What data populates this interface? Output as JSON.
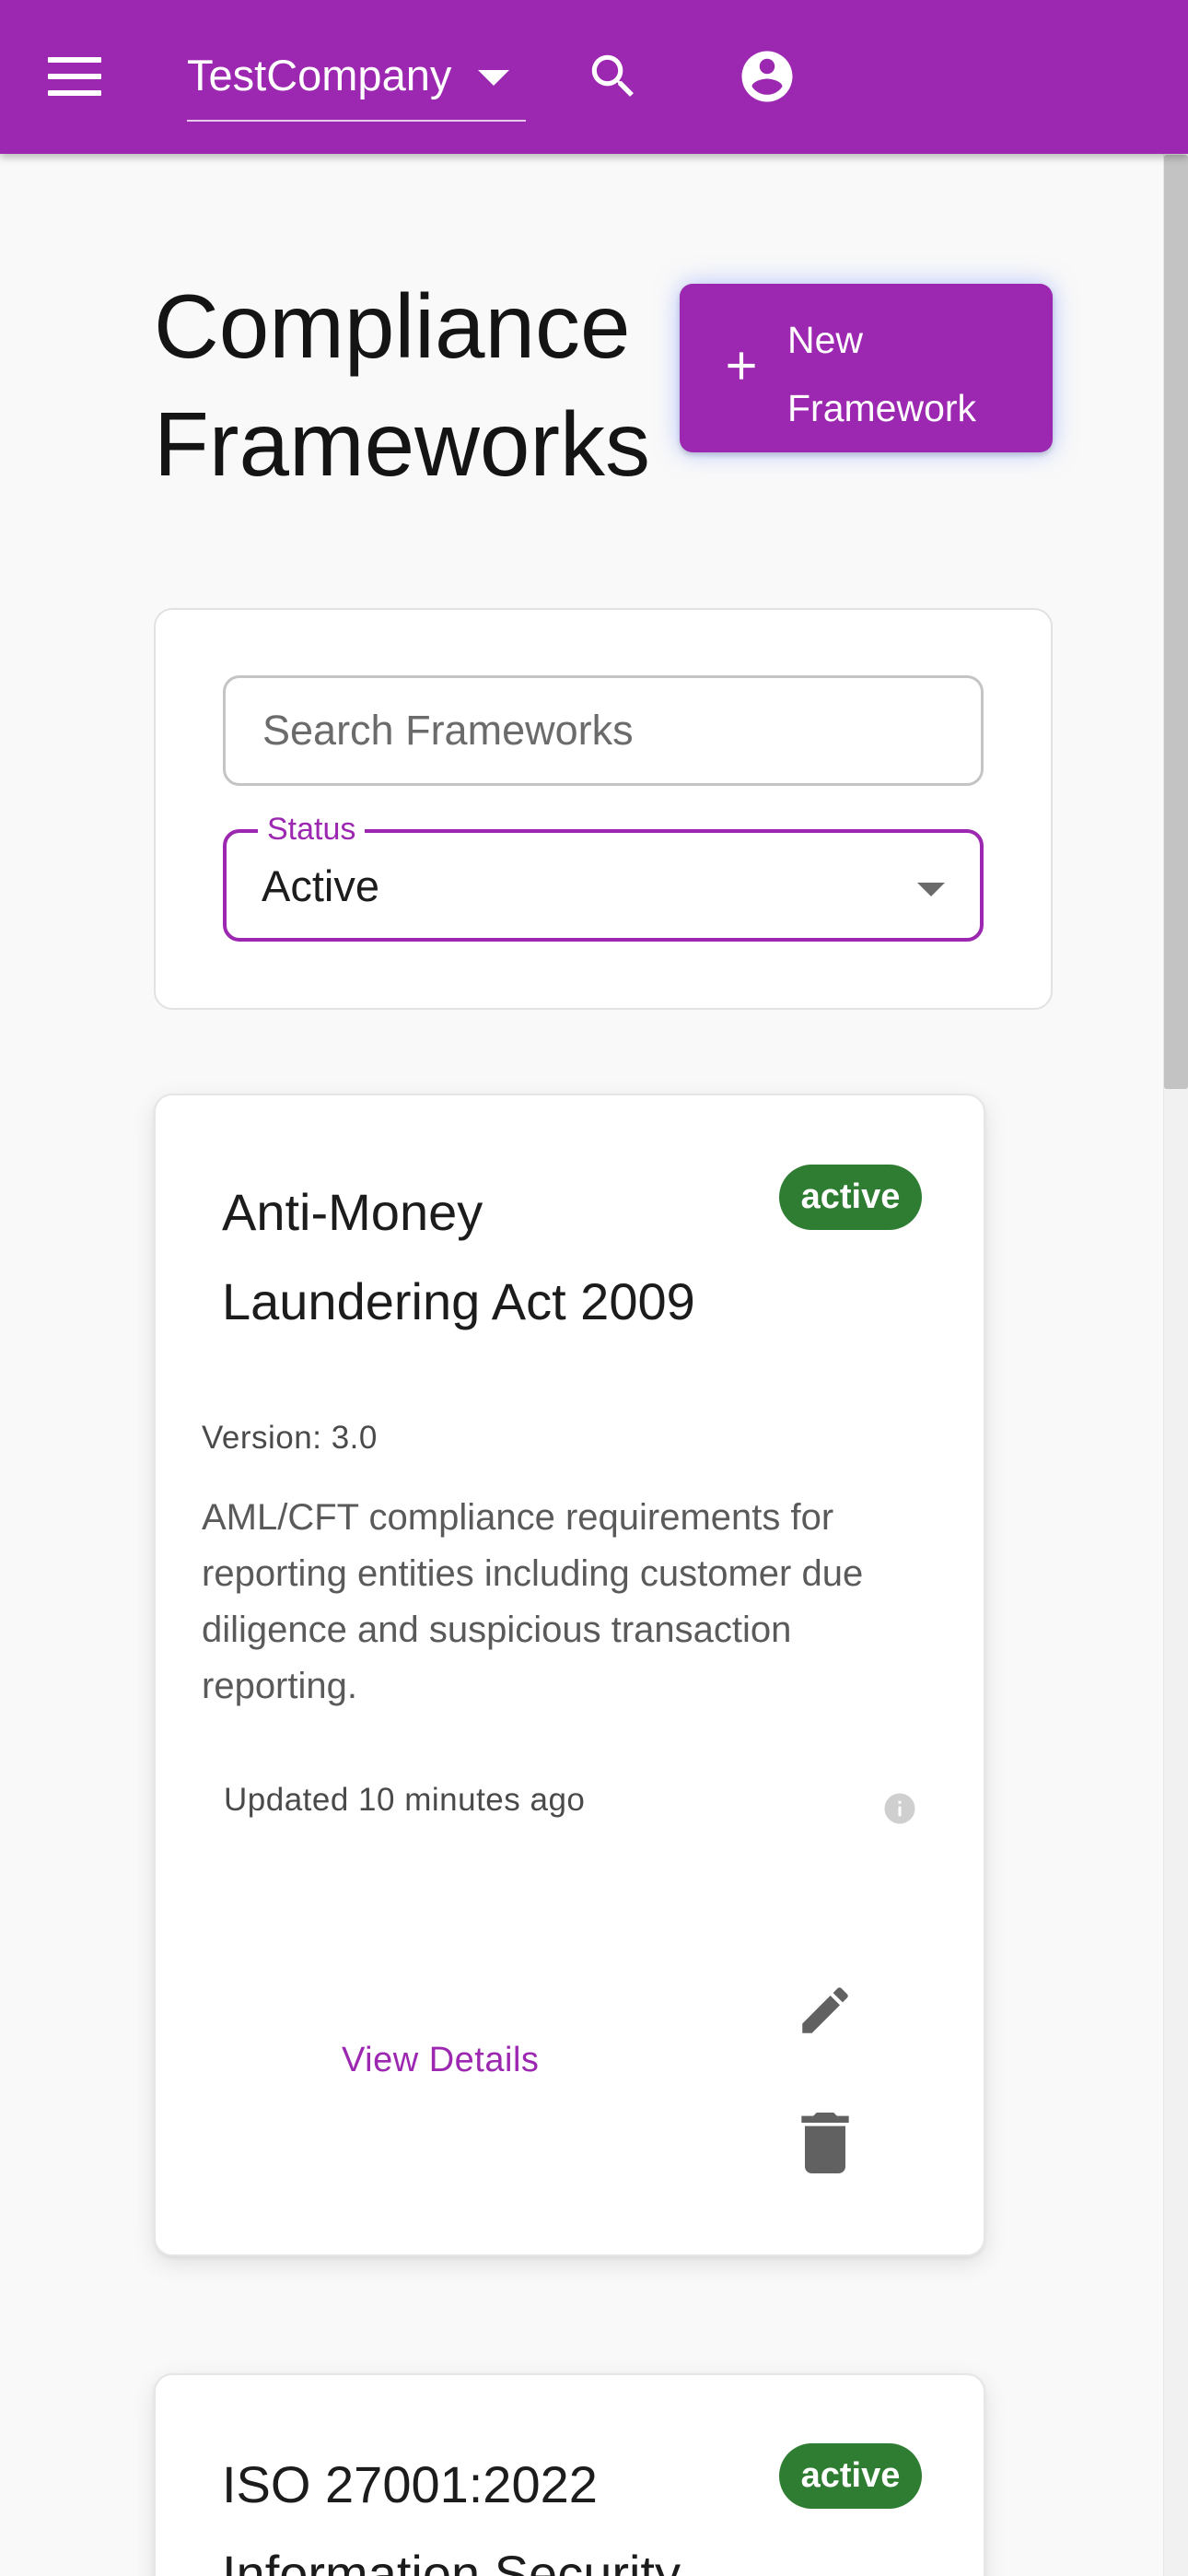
{
  "header": {
    "company": "TestCompany",
    "icons": {
      "menu": "hamburger-menu-icon",
      "search": "search-icon",
      "account": "account-circle-icon"
    }
  },
  "page": {
    "title_line1": "Compliance",
    "title_line2": "Frameworks",
    "new_button_line1": "New",
    "new_button_line2": "Framework"
  },
  "filters": {
    "search_placeholder": "Search Frameworks",
    "search_value": "",
    "status_label": "Status",
    "status_value": "Active"
  },
  "frameworks": [
    {
      "title_line1": "Anti-Money",
      "title_line2": "Laundering Act 2009",
      "status": "active",
      "version": "Version: 3.0",
      "description": "AML/CFT compliance requirements for reporting entities including customer due diligence and suspicious transaction reporting.",
      "updated": "Updated 10 minutes ago",
      "view_label": "View Details"
    },
    {
      "title_line1": "ISO 27001:2022",
      "title_line2": "Information Security",
      "status": "active"
    }
  ],
  "colors": {
    "primary": "#9c27b0",
    "success": "#2e7d32",
    "background": "#f9f9f9"
  }
}
